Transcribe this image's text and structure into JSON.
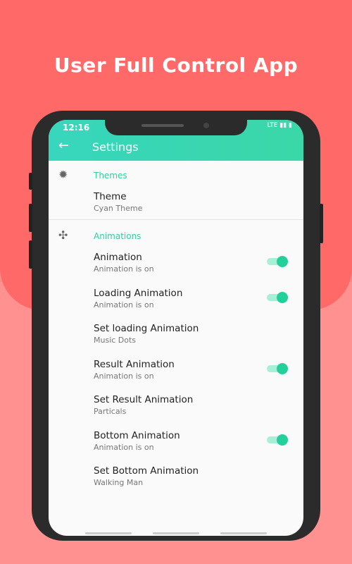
{
  "headline": "User Full Control App",
  "status": {
    "time": "12:16",
    "right": "LTE ▮▮ ▮"
  },
  "appbar": {
    "title": "Settings",
    "back_icon": "arrow-left-icon"
  },
  "themes": {
    "section_title": "Themes",
    "items": [
      {
        "title": "Theme",
        "subtitle": "Cyan Theme"
      }
    ]
  },
  "animations": {
    "section_title": "Animations",
    "items": [
      {
        "title": "Animation",
        "subtitle": "Animation is on",
        "toggle": true
      },
      {
        "title": "Loading Animation",
        "subtitle": "Animation is on",
        "toggle": true
      },
      {
        "title": "Set loading Animation",
        "subtitle": "Music Dots",
        "toggle": false
      },
      {
        "title": "Result Animation",
        "subtitle": "Animation is on",
        "toggle": true
      },
      {
        "title": "Set Result Animation",
        "subtitle": "Particals",
        "toggle": false
      },
      {
        "title": "Bottom Animation",
        "subtitle": "Animation is on",
        "toggle": true
      },
      {
        "title": "Set Bottom Animation",
        "subtitle": "Walking Man",
        "toggle": false
      }
    ]
  },
  "colors": {
    "accent": "#2fcf9e",
    "appbar": "#38d6bd",
    "background": "#ff6a68"
  }
}
